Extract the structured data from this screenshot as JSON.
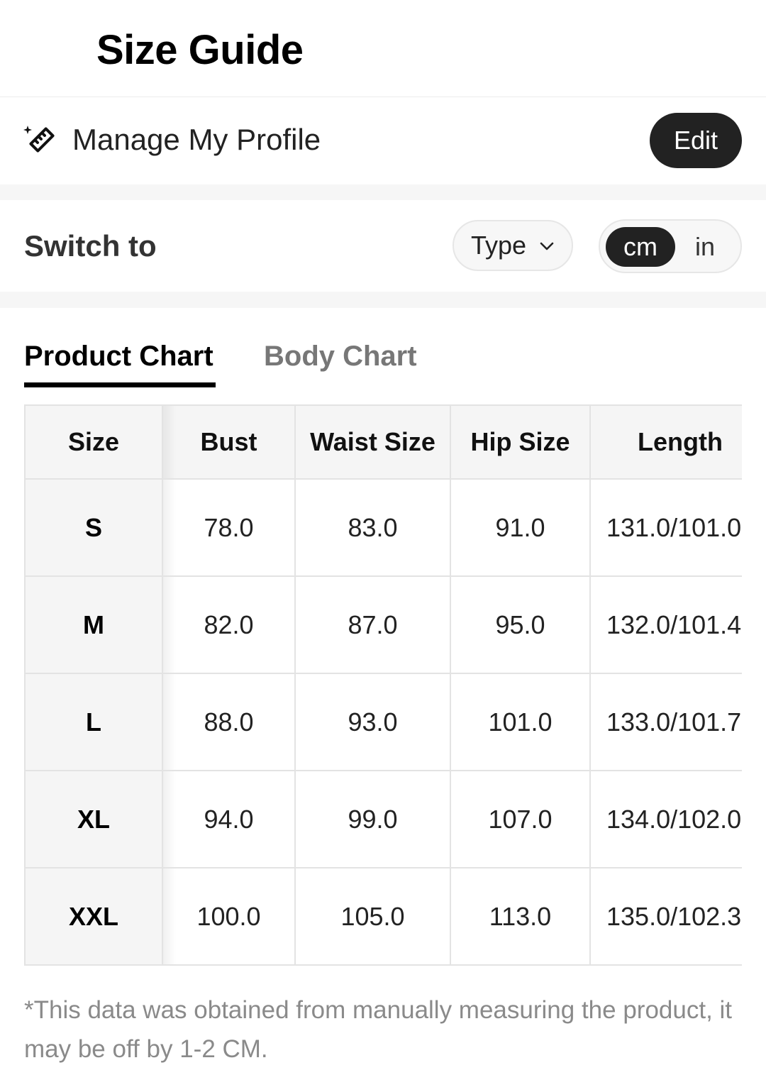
{
  "header": {
    "title": "Size Guide"
  },
  "profile": {
    "label": "Manage My Profile",
    "icon": "ruler-sparkle-icon",
    "edit_label": "Edit"
  },
  "switch": {
    "label": "Switch to",
    "type_label": "Type",
    "units": [
      "cm",
      "in"
    ],
    "selected_unit": "cm"
  },
  "tabs": [
    {
      "label": "Product Chart",
      "active": true
    },
    {
      "label": "Body Chart",
      "active": false
    }
  ],
  "table": {
    "columns": [
      "Size",
      "Bust",
      "Waist Size",
      "Hip Size",
      "Length"
    ],
    "rows": [
      [
        "S",
        "78.0",
        "83.0",
        "91.0",
        "131.0/101.0"
      ],
      [
        "M",
        "82.0",
        "87.0",
        "95.0",
        "132.0/101.4"
      ],
      [
        "L",
        "88.0",
        "93.0",
        "101.0",
        "133.0/101.7"
      ],
      [
        "XL",
        "94.0",
        "99.0",
        "107.0",
        "134.0/102.0"
      ],
      [
        "XXL",
        "100.0",
        "105.0",
        "113.0",
        "135.0/102.3"
      ]
    ]
  },
  "footnote": "*This data was obtained from manually measuring the product, it may be off by 1-2 CM.",
  "colors": {
    "accent": "#222222",
    "section_gap": "#f6f6f6",
    "header_cell": "#f5f5f5",
    "border": "#e3e3e3",
    "muted_text": "#8a8a8a"
  }
}
